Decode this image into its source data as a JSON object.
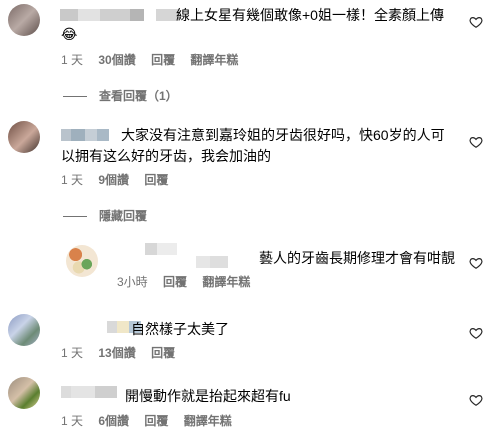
{
  "comments": [
    {
      "text_line1": "線上女星有幾個敢像+0姐一樣！全素顏上傳",
      "text_line2": "😂",
      "meta": {
        "time": "1 天",
        "likes": "30個讚",
        "reply": "回覆",
        "translate": "翻譯年糕"
      },
      "view_replies": "查看回覆（1）"
    },
    {
      "text_line1": "大家没有注意到嘉玲姐的牙齿很好吗，快60岁的人可",
      "text_line2": "以拥有这么好的牙齿，我会加油的",
      "meta": {
        "time": "1 天",
        "likes": "9個讚",
        "reply": "回覆"
      },
      "hide_replies": "隱藏回覆"
    },
    {
      "reply": true,
      "text": "藝人的牙齒長期修理才會有咁靚",
      "meta": {
        "time": "3小時",
        "reply": "回覆",
        "translate": "翻譯年糕"
      }
    },
    {
      "text": "自然樣子太美了",
      "meta": {
        "time": "1 天",
        "likes": "13個讚",
        "reply": "回覆"
      }
    },
    {
      "text": "開慢動作就是抬起來超有fu",
      "meta": {
        "time": "1 天",
        "likes": "6個讚",
        "reply": "回覆",
        "translate": "翻譯年糕"
      }
    }
  ],
  "colors": {
    "meta": "#737373",
    "text": "#000000",
    "icon": "#262626"
  },
  "icons": [
    "heart-icon",
    "avatar"
  ]
}
